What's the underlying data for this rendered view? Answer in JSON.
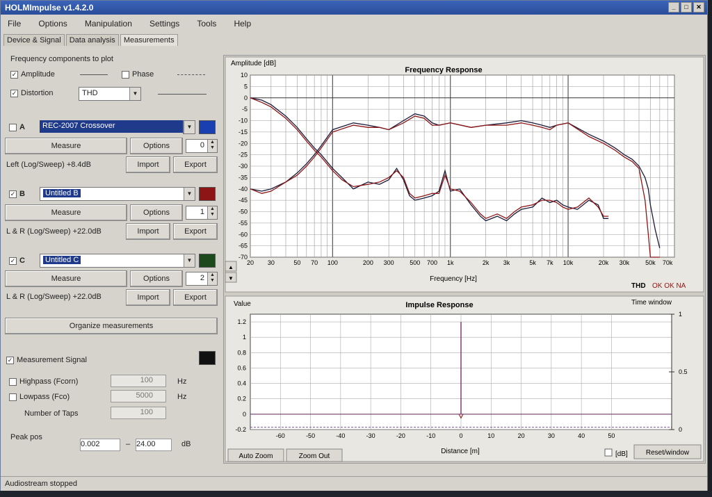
{
  "window": {
    "title": "HOLMImpulse v1.4.2.0"
  },
  "menu": [
    "File",
    "Options",
    "Manipulation",
    "Settings",
    "Tools",
    "Help"
  ],
  "tabs": [
    "Device & Signal",
    "Data analysis",
    "Measurements"
  ],
  "left": {
    "freq_title": "Frequency components to plot",
    "amplitude": "Amplitude",
    "phase": "Phase",
    "distortion": "Distortion",
    "distortion_value": "THD",
    "channels": [
      {
        "letter": "A",
        "name": "REC-2007 Crossover",
        "measure": "Measure",
        "options": "Options",
        "spin": "0",
        "info": "Left (Log/Sweep) +8.4dB",
        "import": "Import",
        "export": "Export",
        "color": "#1a3fb0"
      },
      {
        "letter": "B",
        "name": "Untitled B",
        "measure": "Measure",
        "options": "Options",
        "spin": "1",
        "info": "L & R (Log/Sweep) +22.0dB",
        "import": "Import",
        "export": "Export",
        "color": "#8e1515"
      },
      {
        "letter": "C",
        "name": "Untitled C",
        "measure": "Measure",
        "options": "Options",
        "spin": "2",
        "info": "L & R (Log/Sweep) +22.0dB",
        "import": "Import",
        "export": "Export",
        "color": "#1d4a1d"
      }
    ],
    "organize": "Organize measurements",
    "meas_signal": "Measurement Signal",
    "highpass": "Highpass (Fcorn)",
    "highpass_val": "100",
    "hz1": "Hz",
    "lowpass": "Lowpass (Fco)",
    "lowpass_val": "5000",
    "hz2": "Hz",
    "taps": "Number of Taps",
    "taps_val": "100",
    "peak": "Peak pos",
    "peak_from": "0.002",
    "peak_to": "24.00",
    "peak_unit": "dB"
  },
  "freq_plot": {
    "title": "Frequency Response",
    "ylabel": "Amplitude [dB]",
    "xlabel": "Frequency [Hz]",
    "legend_prefix": "THD",
    "legend_curves": "OK OK NA",
    "y_ticks": [
      "10",
      "5",
      "0",
      "-5",
      "-10",
      "-15",
      "-20",
      "-25",
      "-30",
      "-35",
      "-40",
      "-45",
      "-50",
      "-55",
      "-60",
      "-65",
      "-70"
    ],
    "x_ticks": [
      "20",
      "30",
      "50",
      "70",
      "100",
      "200",
      "300",
      "500",
      "700",
      "1k",
      "2k",
      "3k",
      "5k",
      "7k",
      "10k",
      "20k",
      "30k",
      "50k",
      "70k"
    ]
  },
  "imp_plot": {
    "title": "Impulse Response",
    "ylabel": "Value",
    "xlabel": "Distance [m]",
    "right_label": "Time window",
    "y_ticks": [
      "1.2",
      "1",
      "0.8",
      "0.6",
      "0.4",
      "0.2",
      "0",
      "-0.2"
    ],
    "x_ticks": [
      "-60",
      "-50",
      "-40",
      "-30",
      "-20",
      "-10",
      "0",
      "10",
      "20",
      "30",
      "40",
      "50"
    ],
    "right_ticks": [
      "1",
      "0.5",
      "0"
    ],
    "auto_zoom": "Auto Zoom",
    "zoom_out": "Zoom Out",
    "db": "[dB]",
    "reset": "Reset/window"
  },
  "status": "Audiostream stopped",
  "chart_data": {
    "type": "line",
    "title": "Frequency Response",
    "xlabel": "Frequency [Hz]",
    "ylabel": "Amplitude [dB]",
    "xscale": "log",
    "xlim": [
      20,
      80000
    ],
    "ylim": [
      -70,
      10
    ],
    "series": [
      {
        "color": "#1a1a3a",
        "x": [
          20,
          25,
          30,
          40,
          50,
          60,
          70,
          80,
          100,
          150,
          200,
          250,
          300,
          400,
          500,
          600,
          700,
          800,
          1000,
          1500,
          2000,
          3000,
          4000,
          5000,
          6000,
          7000,
          8000,
          10000,
          15000,
          20000,
          25000,
          30000,
          35000,
          40000,
          45000,
          48000,
          50000,
          55000,
          60000
        ],
        "y": [
          -40,
          -41,
          -40,
          -37,
          -33,
          -29,
          -25,
          -21,
          -14,
          -11,
          -12,
          -13,
          -14,
          -10,
          -7,
          -8,
          -11,
          -12,
          -11,
          -13,
          -12,
          -11,
          -10,
          -11,
          -12,
          -13,
          -12,
          -11,
          -16,
          -19,
          -22,
          -25,
          -27,
          -30,
          -35,
          -40,
          -47,
          -58,
          -66
        ]
      },
      {
        "color": "#8e1515",
        "x": [
          20,
          25,
          30,
          40,
          50,
          60,
          70,
          80,
          100,
          150,
          200,
          250,
          300,
          400,
          500,
          600,
          700,
          800,
          1000,
          1500,
          2000,
          3000,
          4000,
          5000,
          6000,
          7000,
          8000,
          10000,
          15000,
          20000,
          25000,
          30000,
          35000,
          40000,
          45000,
          48000,
          50000,
          55000,
          60000
        ],
        "y": [
          -40,
          -42,
          -41,
          -37,
          -34,
          -30,
          -26,
          -22,
          -15,
          -12,
          -13,
          -13,
          -14,
          -11,
          -8,
          -9,
          -12,
          -12,
          -11,
          -13,
          -12,
          -12,
          -11,
          -12,
          -13,
          -14,
          -12,
          -11,
          -17,
          -20,
          -23,
          -26,
          -28,
          -31,
          -45,
          -60,
          -72,
          -72,
          -72
        ]
      },
      {
        "color": "#1a1a3a",
        "x": [
          20,
          25,
          30,
          40,
          50,
          60,
          70,
          80,
          100,
          120,
          150,
          200,
          250,
          300,
          350,
          400,
          450,
          500,
          600,
          700,
          800,
          900,
          1000,
          1200,
          1500,
          1800,
          2000,
          2500,
          3000,
          3500,
          4000,
          5000,
          6000,
          7000,
          8000,
          9000,
          10000,
          12000,
          15000,
          18000,
          20000,
          22000
        ],
        "y": [
          0,
          -1,
          -3,
          -8,
          -13,
          -18,
          -22,
          -25,
          -31,
          -35,
          -40,
          -37,
          -38,
          -36,
          -31,
          -36,
          -43,
          -45,
          -44,
          -43,
          -41,
          -32,
          -41,
          -40,
          -47,
          -52,
          -54,
          -52,
          -54,
          -51,
          -49,
          -48,
          -44,
          -46,
          -45,
          -47,
          -48,
          -49,
          -45,
          -47,
          -53,
          -53
        ]
      },
      {
        "color": "#8e1515",
        "x": [
          20,
          25,
          30,
          40,
          50,
          60,
          70,
          80,
          100,
          120,
          150,
          200,
          250,
          300,
          350,
          400,
          450,
          500,
          600,
          700,
          800,
          900,
          1000,
          1200,
          1500,
          1800,
          2000,
          2500,
          3000,
          3500,
          4000,
          5000,
          6000,
          7000,
          8000,
          9000,
          10000,
          12000,
          15000,
          18000,
          20000,
          22000
        ],
        "y": [
          0,
          -2,
          -4,
          -9,
          -14,
          -19,
          -23,
          -26,
          -32,
          -36,
          -39,
          -38,
          -37,
          -35,
          -32,
          -35,
          -42,
          -44,
          -43,
          -42,
          -42,
          -34,
          -40,
          -41,
          -46,
          -51,
          -53,
          -51,
          -53,
          -50,
          -48,
          -47,
          -45,
          -45,
          -46,
          -48,
          -49,
          -48,
          -44,
          -48,
          -52,
          -52
        ]
      }
    ]
  }
}
